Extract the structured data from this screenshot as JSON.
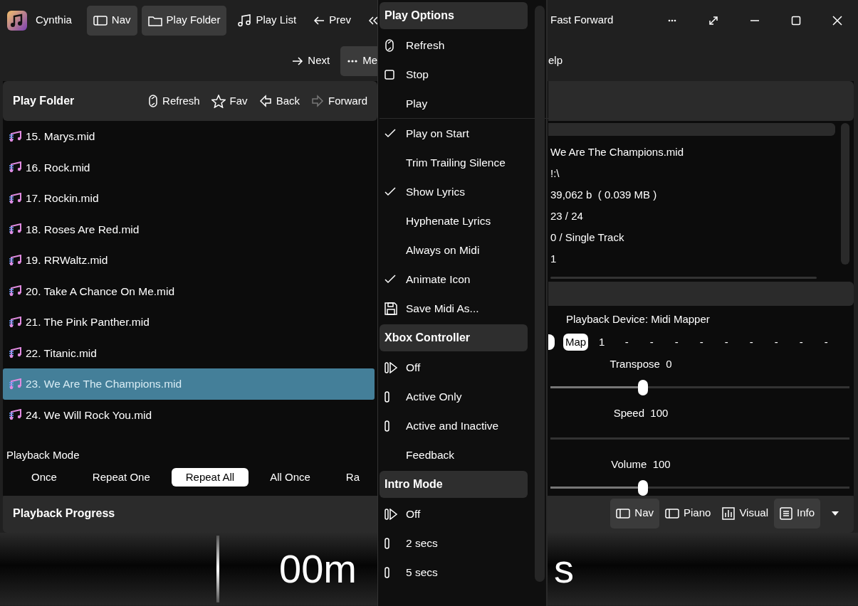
{
  "app": {
    "title": "Cynthia"
  },
  "toolbar": {
    "row_1": [
      {
        "label": "Nav",
        "kind": "nav",
        "selected": true
      },
      {
        "label": "Play Folder",
        "kind": "folder",
        "selected": true
      },
      {
        "label": "Play List",
        "kind": "playlist",
        "selected": false
      },
      {
        "label": "Prev",
        "kind": "prev",
        "selected": false
      },
      {
        "kind": "rewind",
        "selected": false
      }
    ],
    "row_1_right": [
      {
        "label": "Fast Forward",
        "selected": false
      }
    ],
    "row_2": [
      {
        "label": "Next",
        "kind": "next",
        "selected": false
      },
      {
        "label": "Me",
        "kind": "more",
        "selected": true
      }
    ],
    "row_2_right": [
      {
        "label": "elp",
        "selected": false
      }
    ]
  },
  "play_folder": {
    "title": "Play Folder",
    "actions": [
      {
        "label": "Refresh",
        "kind": "refresh"
      },
      {
        "label": "Fav",
        "kind": "star"
      },
      {
        "label": "Back",
        "kind": "back"
      },
      {
        "label": "Forward",
        "kind": "forward"
      }
    ]
  },
  "files": [
    {
      "name": "15. Marys.mid",
      "selected": false
    },
    {
      "name": "16. Rock.mid",
      "selected": false
    },
    {
      "name": "17. Rockin.mid",
      "selected": false
    },
    {
      "name": "18. Roses Are Red.mid",
      "selected": false
    },
    {
      "name": "19. RRWaltz.mid",
      "selected": false
    },
    {
      "name": "20. Take A Chance On Me.mid",
      "selected": false
    },
    {
      "name": "21. The Pink Panther.mid",
      "selected": false
    },
    {
      "name": "22. Titanic.mid",
      "selected": false
    },
    {
      "name": "23. We Are The Champions.mid",
      "selected": true
    },
    {
      "name": "24. We Will Rock You.mid",
      "selected": false
    }
  ],
  "playback_mode": {
    "label": "Playback Mode",
    "options": [
      {
        "label": "Once",
        "selected": false
      },
      {
        "label": "Repeat One",
        "selected": false
      },
      {
        "label": "Repeat All",
        "selected": true
      },
      {
        "label": "All Once",
        "selected": false
      },
      {
        "label": "Ra",
        "selected": false
      }
    ]
  },
  "info": {
    "lines": [
      "We Are The Champions.mid",
      "!:\\",
      "39,062 b  ( 0.039 MB )",
      "23 / 24",
      "0 / Single Track",
      "1"
    ]
  },
  "device": {
    "label": "Playback Device: Midi Mapper",
    "channels": [
      {
        "label": "Map",
        "selected": true
      },
      {
        "label": "1",
        "selected": false
      },
      {
        "label": "-",
        "selected": false
      },
      {
        "label": "-",
        "selected": false
      },
      {
        "label": "-",
        "selected": false
      },
      {
        "label": "-",
        "selected": false
      },
      {
        "label": "-",
        "selected": false
      },
      {
        "label": "-",
        "selected": false
      },
      {
        "label": "-",
        "selected": false
      },
      {
        "label": "-",
        "selected": false
      },
      {
        "label": "-",
        "selected": false
      }
    ]
  },
  "sliders": [
    {
      "label": "Transpose",
      "value": "0",
      "level": 0.31
    },
    {
      "label": "Speed",
      "value": "100"
    },
    {
      "label": "Volume",
      "value": "100",
      "level": 0.31
    }
  ],
  "progress": {
    "title": "Playback Progress",
    "views": [
      {
        "label": "Nav",
        "kind": "nav",
        "selected": true
      },
      {
        "label": "Piano",
        "kind": "nav",
        "selected": false
      },
      {
        "label": "Visual",
        "kind": "visual",
        "selected": false
      },
      {
        "label": "Info",
        "kind": "info",
        "selected": true
      }
    ],
    "time_left": "00m",
    "time_right": "s"
  },
  "menu": {
    "sections": [
      {
        "title": "Play Options",
        "items": [
          {
            "kind": "refresh",
            "label": "Refresh"
          },
          {
            "kind": "stop",
            "label": "Stop"
          },
          {
            "kind": "command",
            "label": "Play"
          },
          {
            "kind": "separator"
          },
          {
            "kind": "check",
            "label": "Play on Start",
            "checked": true
          },
          {
            "kind": "check",
            "label": "Trim Trailing Silence",
            "checked": false
          },
          {
            "kind": "check",
            "label": "Show Lyrics",
            "checked": true
          },
          {
            "kind": "check",
            "label": "Hyphenate Lyrics",
            "checked": false
          },
          {
            "kind": "check",
            "label": "Always on Midi",
            "checked": false
          },
          {
            "kind": "check",
            "label": "Animate Icon",
            "checked": true
          },
          {
            "kind": "save",
            "label": "Save Midi As..."
          }
        ]
      },
      {
        "title": "Xbox Controller",
        "items": [
          {
            "kind": "radio",
            "label": "Off",
            "selected": true
          },
          {
            "kind": "radio",
            "label": "Active Only",
            "selected": false
          },
          {
            "kind": "radio",
            "label": "Active and Inactive",
            "selected": false
          },
          {
            "kind": "command",
            "label": "Feedback"
          }
        ]
      },
      {
        "title": "Intro Mode",
        "items": [
          {
            "kind": "radio",
            "label": "Off",
            "selected": true
          },
          {
            "kind": "radio",
            "label": "2 secs",
            "selected": false
          },
          {
            "kind": "radio",
            "label": "5 secs",
            "selected": false
          }
        ]
      }
    ]
  }
}
